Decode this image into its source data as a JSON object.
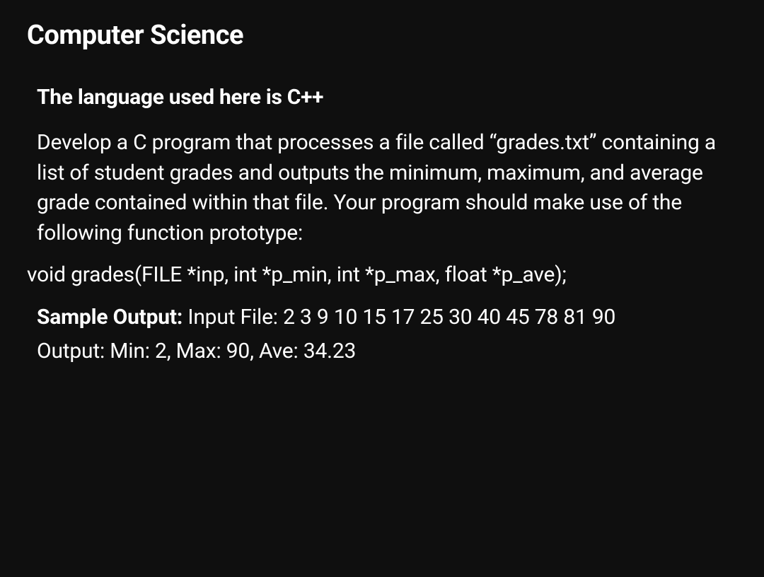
{
  "title": "Computer Science",
  "language_note": "The language used here is C++",
  "description": "Develop a C program that processes a file called “grades.txt” containing a list of student grades and outputs the minimum, maximum, and average grade contained within that file. Your program should make use of the following function prototype:",
  "prototype": "void grades(FILE *inp, int *p_min, int *p_max, float *p_ave);",
  "sample": {
    "label": "Sample Output: ",
    "input_text": "Input File: 2 3 9 10 15 17 25 30 40 45 78 81 90",
    "output_text": "Output: Min: 2, Max: 90, Ave: 34.23"
  }
}
